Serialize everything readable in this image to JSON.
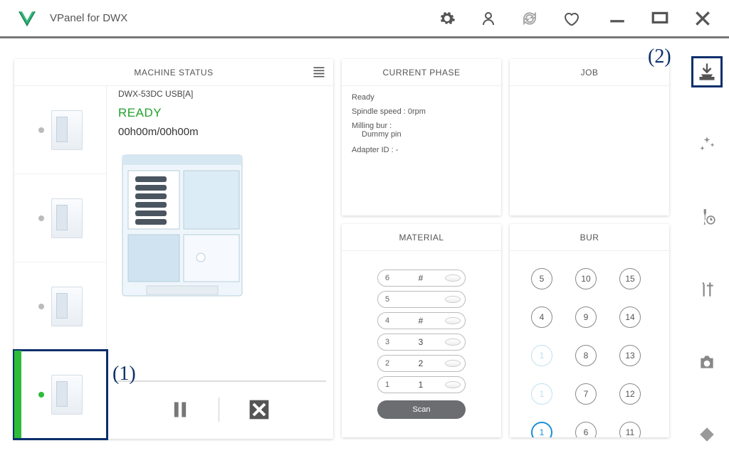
{
  "titlebar": {
    "title": "VPanel for DWX"
  },
  "annotations": {
    "one": "(1)",
    "two": "(2)"
  },
  "status": {
    "header": "MACHINE STATUS",
    "device": "DWX-53DC USB[A]",
    "state": "READY",
    "time": "00h00m/00h00m"
  },
  "phase": {
    "header": "CURRENT PHASE",
    "ready": "Ready",
    "spindle": "Spindle speed : 0rpm",
    "bur_label": "Milling bur :",
    "bur_value": "Dummy pin",
    "adapter": "Adapter ID : -"
  },
  "job": {
    "header": "JOB"
  },
  "material": {
    "header": "MATERIAL",
    "rows": [
      {
        "slot": "1",
        "value": "1"
      },
      {
        "slot": "2",
        "value": "2"
      },
      {
        "slot": "3",
        "value": "3"
      },
      {
        "slot": "4",
        "value": "#"
      },
      {
        "slot": "5",
        "value": ""
      },
      {
        "slot": "6",
        "value": "#"
      }
    ],
    "scan": "Scan"
  },
  "bur": {
    "header": "BUR",
    "cells": [
      {
        "n": "5",
        "state": ""
      },
      {
        "n": "10",
        "state": ""
      },
      {
        "n": "15",
        "state": ""
      },
      {
        "n": "4",
        "state": ""
      },
      {
        "n": "9",
        "state": ""
      },
      {
        "n": "14",
        "state": ""
      },
      {
        "n": "1",
        "state": "faded"
      },
      {
        "n": "8",
        "state": ""
      },
      {
        "n": "13",
        "state": ""
      },
      {
        "n": "1",
        "state": "faded"
      },
      {
        "n": "7",
        "state": ""
      },
      {
        "n": "12",
        "state": ""
      },
      {
        "n": "1",
        "state": "active"
      },
      {
        "n": "6",
        "state": ""
      },
      {
        "n": "11",
        "state": ""
      }
    ]
  }
}
